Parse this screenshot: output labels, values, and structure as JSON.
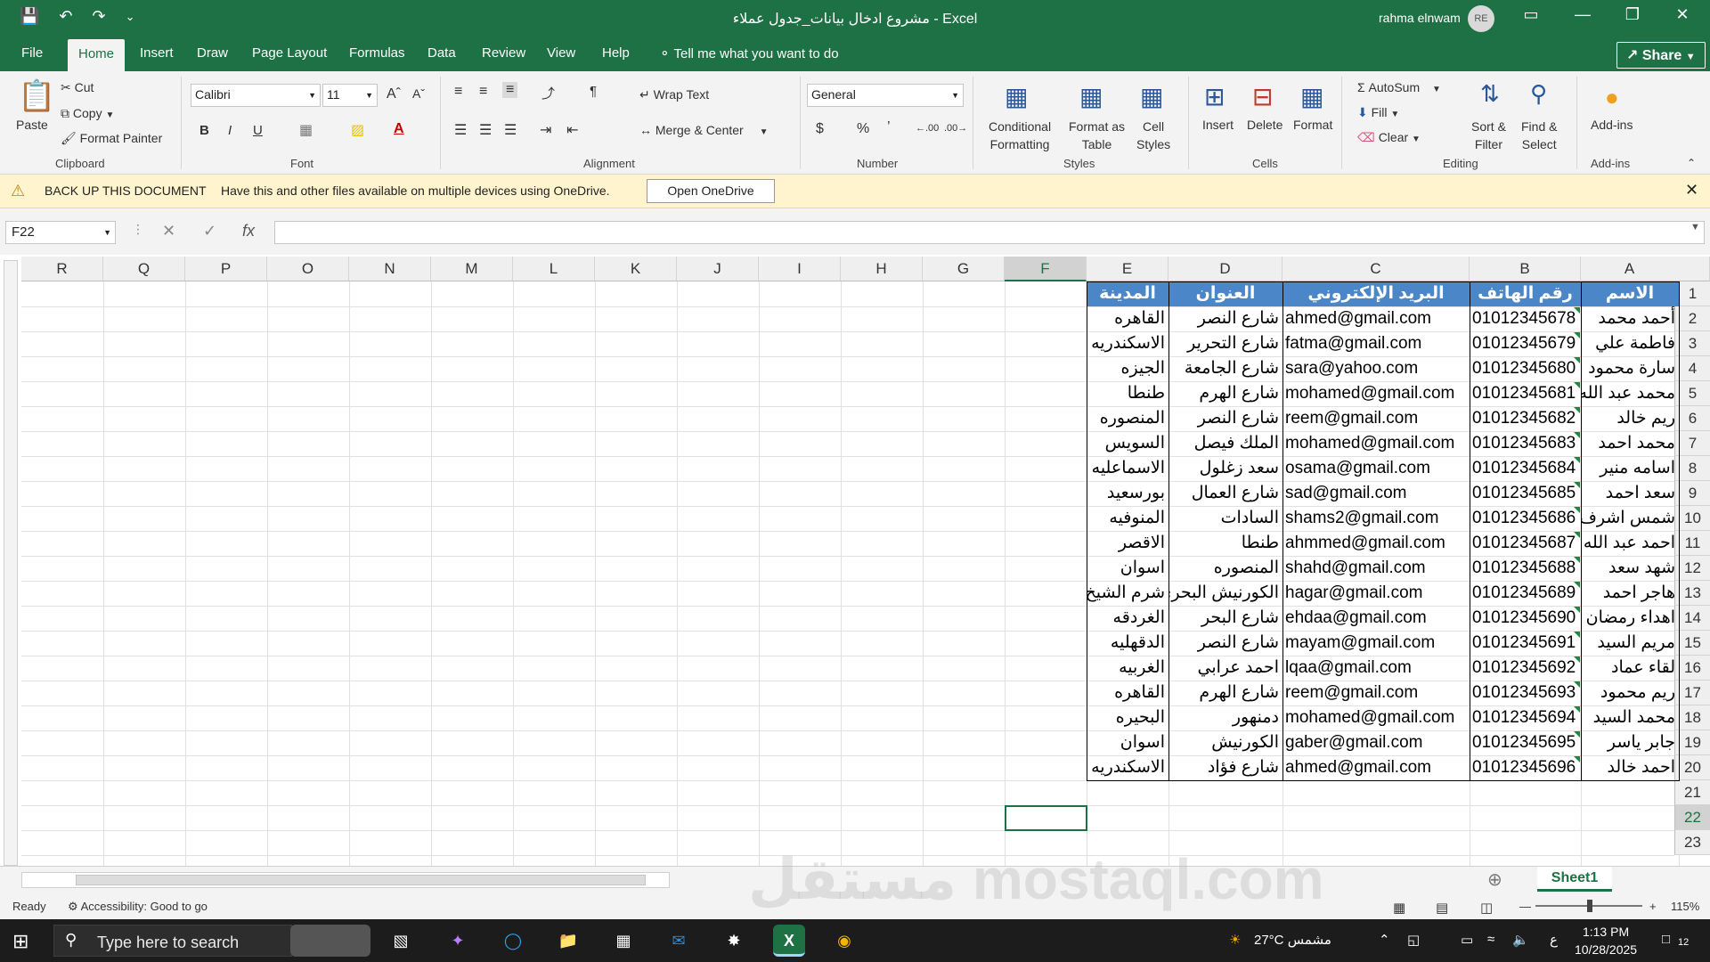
{
  "titlebar": {
    "title": "مشروع ادخال بيانات_جدول عملاء  -  Excel",
    "user": "rahma elnwam",
    "avatar_initials": "RE"
  },
  "menu": {
    "tabs": [
      "File",
      "Home",
      "Insert",
      "Draw",
      "Page Layout",
      "Formulas",
      "Data",
      "Review",
      "View",
      "Help"
    ],
    "active": "Home",
    "tell_me": "Tell me what you want to do",
    "share": "Share"
  },
  "ribbon": {
    "clipboard": {
      "paste": "Paste",
      "cut": "Cut",
      "copy": "Copy",
      "format_painter": "Format Painter",
      "group": "Clipboard"
    },
    "font": {
      "family": "Calibri",
      "size": "11",
      "group": "Font",
      "bold": "B",
      "italic": "I",
      "underline": "U"
    },
    "alignment": {
      "wrap_text": "Wrap Text",
      "merge_center": "Merge & Center",
      "group": "Alignment"
    },
    "number": {
      "format": "General",
      "group": "Number"
    },
    "styles": {
      "conditional": "Conditional",
      "conditional2": "Formatting",
      "format_as": "Format as",
      "format_as2": "Table",
      "cell": "Cell",
      "cell2": "Styles",
      "group": "Styles"
    },
    "cells": {
      "insert": "Insert",
      "delete": "Delete",
      "format": "Format",
      "group": "Cells"
    },
    "editing": {
      "autosum": "AutoSum",
      "fill": "Fill",
      "clear": "Clear",
      "sort": "Sort &",
      "sort2": "Filter",
      "find": "Find &",
      "find2": "Select",
      "group": "Editing"
    },
    "addins": {
      "label": "Add-ins",
      "group": "Add-ins"
    }
  },
  "warning": {
    "title": "BACK UP THIS DOCUMENT",
    "message": "Have this and other files available on multiple devices using OneDrive.",
    "button": "Open OneDrive"
  },
  "formula_bar": {
    "name_box": "F22",
    "fx": "fx",
    "content": ""
  },
  "columns": [
    "R",
    "Q",
    "P",
    "O",
    "N",
    "M",
    "L",
    "K",
    "J",
    "I",
    "H",
    "G",
    "F",
    "E",
    "D",
    "C",
    "B",
    "A"
  ],
  "rows": [
    "1",
    "2",
    "3",
    "4",
    "5",
    "6",
    "7",
    "8",
    "9",
    "10",
    "11",
    "12",
    "13",
    "14",
    "15",
    "16",
    "17",
    "18",
    "19",
    "20",
    "21",
    "22",
    "23"
  ],
  "table": {
    "headers": {
      "name": "الاسم",
      "phone": "رقم الهاتف",
      "email": "البريد الإلكتروني",
      "address": "العنوان",
      "city": "المدينة"
    },
    "records": [
      {
        "name": "أحمد محمد",
        "phone": "01012345678",
        "email": "ahmed@gmail.com",
        "address": "شارع النصر",
        "city": "القاهره"
      },
      {
        "name": "فاطمة علي",
        "phone": "01012345679",
        "email": "fatma@gmail.com",
        "address": "شارع التحرير",
        "city": "الاسكندريه"
      },
      {
        "name": "سارة محمود",
        "phone": "01012345680",
        "email": "sara@yahoo.com",
        "address": "شارع الجامعة",
        "city": "الجيزه"
      },
      {
        "name": "محمد عبد الله",
        "phone": "01012345681",
        "email": "mohamed@gmail.com",
        "address": "شارع الهرم",
        "city": "طنطا"
      },
      {
        "name": "ريم خالد",
        "phone": "01012345682",
        "email": "reem@gmail.com",
        "address": "شارع النصر",
        "city": "المنصوره"
      },
      {
        "name": "محمد احمد",
        "phone": "01012345683",
        "email": "mohamed@gmail.com",
        "address": "الملك فيصل",
        "city": "السويس"
      },
      {
        "name": "اسامه منير",
        "phone": "01012345684",
        "email": "osama@gmail.com",
        "address": "سعد زغلول",
        "city": "الاسماعليه"
      },
      {
        "name": "سعد احمد",
        "phone": "01012345685",
        "email": "sad@gmail.com",
        "address": "شارع العمال",
        "city": "بورسعيد"
      },
      {
        "name": "شمس اشرف",
        "phone": "01012345686",
        "email": "shams2@gmail.com",
        "address": "السادات",
        "city": "المنوفيه"
      },
      {
        "name": "احمد عبد الله",
        "phone": "01012345687",
        "email": "ahmmed@gmail.com",
        "address": "طنطا",
        "city": "الاقصر"
      },
      {
        "name": "شهد سعد",
        "phone": "01012345688",
        "email": "shahd@gmail.com",
        "address": "المنصوره",
        "city": "اسوان"
      },
      {
        "name": "هاجر احمد",
        "phone": "01012345689",
        "email": "hagar@gmail.com",
        "address": "الكورنيش البحري",
        "city": "شرم الشيخ"
      },
      {
        "name": "اهداء رمضان",
        "phone": "01012345690",
        "email": "ehdaa@gmail.com",
        "address": "شارع البحر",
        "city": "الغردقه"
      },
      {
        "name": "مريم السيد",
        "phone": "01012345691",
        "email": "mayam@gmail.com",
        "address": "شارع النصر",
        "city": "الدقهليه"
      },
      {
        "name": "لقاء عماد",
        "phone": "01012345692",
        "email": "lqaa@gmail.com",
        "address": "احمد عرابي",
        "city": "الغربيه"
      },
      {
        "name": "ريم محمود",
        "phone": "01012345693",
        "email": "reem@gmail.com",
        "address": "شارع الهرم",
        "city": "القاهره"
      },
      {
        "name": "محمد السيد",
        "phone": "01012345694",
        "email": "mohamed@gmail.com",
        "address": "دمنهور",
        "city": "البحيره"
      },
      {
        "name": "جابر ياسر",
        "phone": "01012345695",
        "email": "gaber@gmail.com",
        "address": "الكورنيش",
        "city": "اسوان"
      },
      {
        "name": "احمد خالد",
        "phone": "01012345696",
        "email": "ahmed@gmail.com",
        "address": "شارع فؤاد",
        "city": "الاسكندريه"
      }
    ]
  },
  "sheet_tabs": [
    "Sheet1"
  ],
  "status": {
    "ready": "Ready",
    "accessibility": "Accessibility: Good to go",
    "zoom": "115%"
  },
  "taskbar": {
    "search_placeholder": "Type here to search",
    "weather": "27°C  مشمس",
    "lang": "ع",
    "time": "1:13 PM",
    "date": "10/28/2025",
    "notifications": "12"
  },
  "watermark": "مستقل mostaql.com",
  "colors": {
    "excel_green": "#1e7145",
    "header_blue": "#4a86c8",
    "warning_yellow": "#fff4ce"
  }
}
